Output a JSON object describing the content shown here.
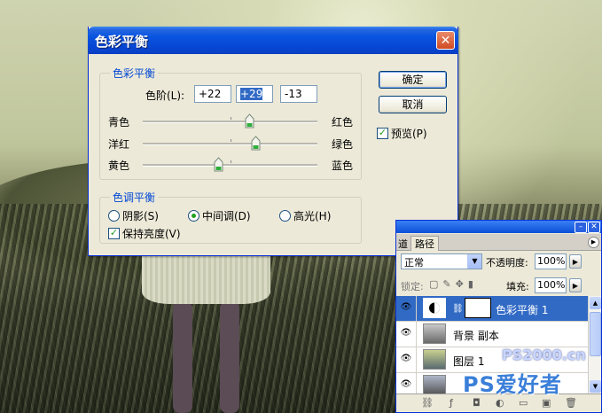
{
  "dialog": {
    "title": "色彩平衡",
    "close_glyph": "✕",
    "color_balance_group": {
      "legend": "色彩平衡",
      "levels_label": "色阶(L):",
      "levels": [
        "+22",
        "+29",
        "-13"
      ],
      "sliders": [
        {
          "left": "青色",
          "right": "红色",
          "value": 22
        },
        {
          "left": "洋红",
          "right": "绿色",
          "value": 29
        },
        {
          "left": "黄色",
          "right": "蓝色",
          "value": -13
        }
      ]
    },
    "tone_group": {
      "legend": "色调平衡",
      "shadows": "阴影(S)",
      "midtones": "中间调(D)",
      "highlights": "高光(H)",
      "selected": "midtones",
      "preserve_luminosity": "保持亮度(V)",
      "preserve_checked": true
    },
    "ok_button": "确定",
    "cancel_button": "取消",
    "preview_label": "预览(P)",
    "preview_checked": true
  },
  "layers_panel": {
    "tabs": [
      "道",
      "路径"
    ],
    "blend_mode": "正常",
    "opacity_label": "不透明度:",
    "opacity_value": "100%",
    "lock_label": "锁定:",
    "fill_label": "填充:",
    "fill_value": "100%",
    "layers": [
      {
        "name": "色彩平衡 1",
        "selected": true
      },
      {
        "name": "背景 副本",
        "selected": false
      },
      {
        "name": "图层 1",
        "selected": false
      }
    ]
  },
  "watermark": {
    "line1": "PS2000.cn",
    "line2": "PS爱好者"
  }
}
